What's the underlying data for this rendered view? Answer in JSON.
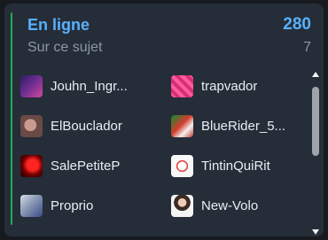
{
  "online_panel": {
    "title": "En ligne",
    "total_count": "280",
    "subtitle": "Sur ce sujet",
    "topic_count": "7",
    "accent_color": "#2fa84f",
    "title_color": "#59b0ff",
    "users": [
      {
        "name": "Jouhn_Ingr...",
        "avatar_icon": "purple-abstract-avatar-icon"
      },
      {
        "name": "trapvador",
        "avatar_icon": "pink-pattern-avatar-icon"
      },
      {
        "name": "ElBouclador",
        "avatar_icon": "photo-avatar-icon"
      },
      {
        "name": "BlueRider_5...",
        "avatar_icon": "christmas-avatar-icon"
      },
      {
        "name": "SalePetiteP",
        "avatar_icon": "red-abstract-avatar-icon"
      },
      {
        "name": "TintinQuiRit",
        "avatar_icon": "red-white-avatar-icon"
      },
      {
        "name": "Proprio",
        "avatar_icon": "character-avatar-icon"
      },
      {
        "name": "New-Volo",
        "avatar_icon": "portrait-avatar-icon"
      }
    ],
    "scrollbar": {
      "up_icon": "scroll-up-arrow-icon",
      "down_icon": "scroll-down-arrow-icon"
    }
  }
}
